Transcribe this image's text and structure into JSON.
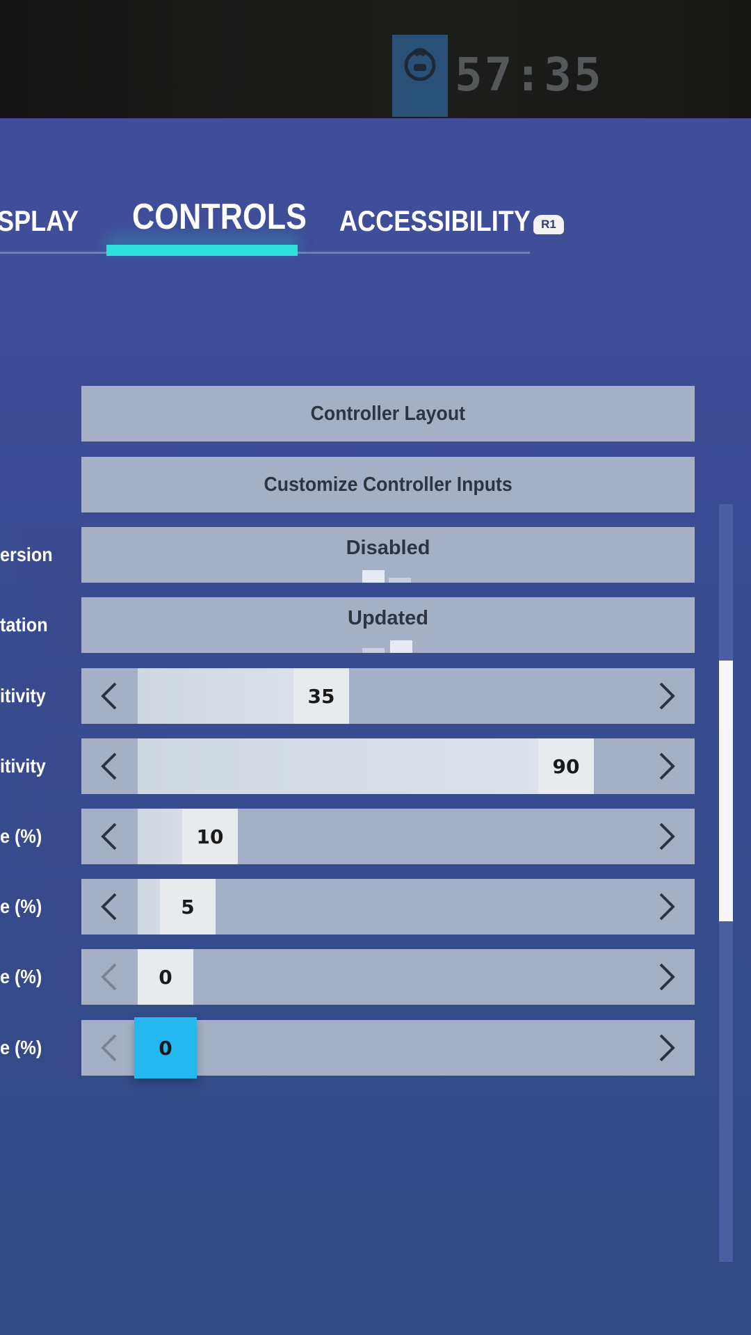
{
  "hud": {
    "timer": "57:35",
    "timer_icon": "vehicle-timer-icon"
  },
  "tabs": [
    {
      "label": "SPLAY",
      "active": false
    },
    {
      "label": "CONTROLS",
      "active": true
    },
    {
      "label": "ACCESSIBILITY",
      "active": false
    }
  ],
  "tab_next_badge": "R1",
  "colors": {
    "active_tab_accent": "#2ee0de",
    "focused_slider": "#25b7f0",
    "panel_bg": "#394c92",
    "row_bg": "#a5b0c6"
  },
  "settings": {
    "controller_layout": {
      "label": "Controller Layout"
    },
    "customize_inputs": {
      "label": "Customize Controller Inputs"
    },
    "inversion": {
      "label": "ersion",
      "value": "Disabled",
      "selected_index": 0,
      "option_count": 2
    },
    "rotation": {
      "label": "tation",
      "value": "Updated",
      "selected_index": 1,
      "option_count": 2
    },
    "sensitivity_1": {
      "label": "itivity",
      "value": "35",
      "fraction": 0.35
    },
    "sensitivity_2": {
      "label": "itivity",
      "value": "90",
      "fraction": 0.9
    },
    "deadzone_1": {
      "label": "e (%)",
      "value": "10",
      "fraction": 0.1
    },
    "deadzone_2": {
      "label": "e (%)",
      "value": "5",
      "fraction": 0.05
    },
    "deadzone_3": {
      "label": "e (%)",
      "value": "0",
      "fraction": 0.0
    },
    "deadzone_4": {
      "label": "e (%)",
      "value": "0",
      "fraction": 0.0,
      "focused": true
    }
  },
  "icons": {
    "left": "chevron-left-icon",
    "right": "chevron-right-icon"
  }
}
